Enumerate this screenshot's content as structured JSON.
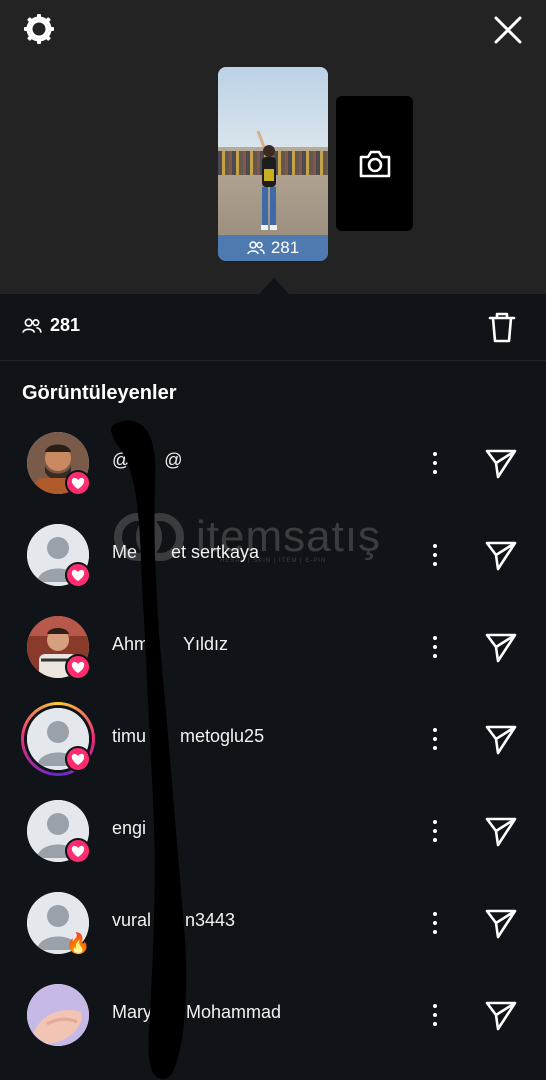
{
  "header": {
    "settings_icon": "gear-icon",
    "close_icon": "close-icon"
  },
  "story": {
    "view_count": "281",
    "camera_icon": "camera-icon"
  },
  "viewers_bar": {
    "count": "281",
    "delete_icon": "trash-icon"
  },
  "section_title": "Görüntüleyenler",
  "viewers": [
    {
      "username": "@",
      "tail": "@",
      "badge": "heart",
      "avatar": "photo-man"
    },
    {
      "username": "Me",
      "tail": "et sertkaya",
      "badge": "heart",
      "avatar": "default"
    },
    {
      "username": "Ahm",
      "tail": "Yıldız",
      "badge": "heart",
      "avatar": "photo-boy"
    },
    {
      "username": "timu",
      "tail": "metoglu25",
      "badge": "heart",
      "avatar": "default-ring"
    },
    {
      "username": "engi",
      "tail": "",
      "badge": "heart",
      "avatar": "default"
    },
    {
      "username": "vural",
      "tail": "n3443",
      "badge": "fire",
      "avatar": "default"
    },
    {
      "username": "Mary",
      "tail": "Mohammad",
      "badge": "",
      "avatar": "photo-hand"
    }
  ],
  "watermark": {
    "text": "itemsatış",
    "sub": "HESAP | SKIN | İTEM | E-PIN",
    "dotcom": ".com"
  }
}
